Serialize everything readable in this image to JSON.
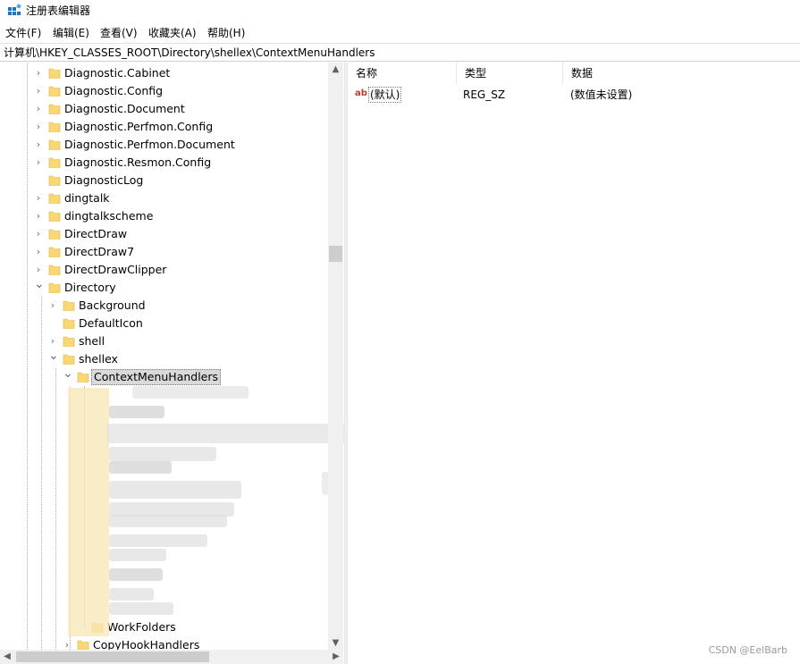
{
  "window": {
    "title": "注册表编辑器"
  },
  "menu": [
    "文件(F)",
    "编辑(E)",
    "查看(V)",
    "收藏夹(A)",
    "帮助(H)"
  ],
  "address": "计算机\\HKEY_CLASSES_ROOT\\Directory\\shellex\\ContextMenuHandlers",
  "tree": {
    "items": [
      {
        "label": "Diagnostic.Cabinet",
        "expander": "collapsed"
      },
      {
        "label": "Diagnostic.Config",
        "expander": "collapsed"
      },
      {
        "label": "Diagnostic.Document",
        "expander": "collapsed"
      },
      {
        "label": "Diagnostic.Perfmon.Config",
        "expander": "collapsed"
      },
      {
        "label": "Diagnostic.Perfmon.Document",
        "expander": "collapsed"
      },
      {
        "label": "Diagnostic.Resmon.Config",
        "expander": "collapsed"
      },
      {
        "label": "DiagnosticLog",
        "expander": "none"
      },
      {
        "label": "dingtalk",
        "expander": "collapsed"
      },
      {
        "label": "dingtalkscheme",
        "expander": "collapsed"
      },
      {
        "label": "DirectDraw",
        "expander": "collapsed"
      },
      {
        "label": "DirectDraw7",
        "expander": "collapsed"
      },
      {
        "label": "DirectDrawClipper",
        "expander": "collapsed"
      },
      {
        "label": "Directory",
        "expander": "expanded"
      },
      {
        "label": "Background",
        "expander": "collapsed"
      },
      {
        "label": "DefaultIcon",
        "expander": "none"
      },
      {
        "label": "shell",
        "expander": "collapsed"
      },
      {
        "label": "shellex",
        "expander": "expanded"
      },
      {
        "label": "ContextMenuHandlers",
        "expander": "expanded",
        "selected": true
      },
      {
        "label": "WorkFolders",
        "expander": "none"
      },
      {
        "label": "CopyHookHandlers",
        "expander": "collapsed"
      }
    ]
  },
  "values": {
    "columns": [
      "名称",
      "类型",
      "数据"
    ],
    "rows": [
      {
        "name": "(默认)",
        "type": "REG_SZ",
        "data": "(数值未设置)",
        "icon": "string-value-icon"
      }
    ]
  },
  "watermark": "CSDN @EelBarb",
  "colors": {
    "folder": "#f8d775",
    "folder_dark": "#e0b440",
    "selection": "#d9d9d9",
    "ab_icon": "#c0392b"
  }
}
